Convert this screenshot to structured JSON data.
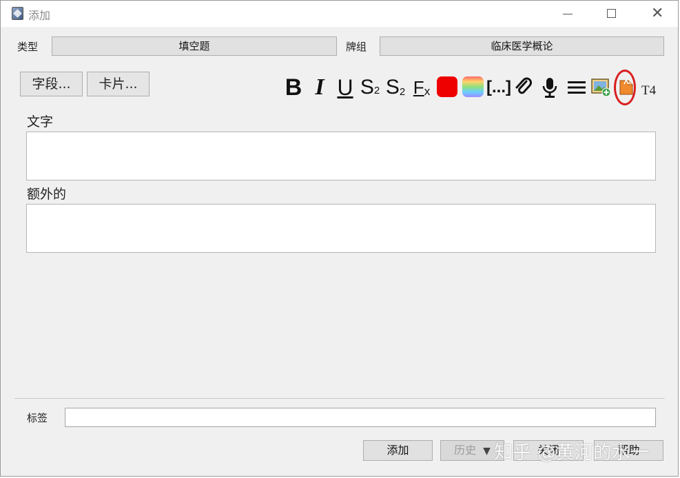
{
  "window": {
    "title": "添加"
  },
  "top": {
    "type_label": "类型",
    "type_value": "填空题",
    "deck_label": "牌组",
    "deck_value": "临床医学概论"
  },
  "buttons": {
    "fields": "字段...",
    "cards": "卡片..."
  },
  "toolbar": {
    "bold": "B",
    "italic": "I",
    "underline": "U",
    "superscript": "S",
    "superscript_mark": "2",
    "subscript": "S",
    "subscript_mark": "2",
    "clear_format": "F",
    "clear_format_mark": "x",
    "text_color": "#ef0000",
    "cloze": "[...]",
    "attach_icon": "paperclip-icon",
    "record_icon": "microphone-icon",
    "more_icon": "menu-icon",
    "image_icon": "image-occlusion-icon",
    "highlighted_icon": "import-icon",
    "t4": "T4",
    "highlight_color": "#d81e1e"
  },
  "fields": [
    {
      "label": "文字",
      "value": ""
    },
    {
      "label": "额外的",
      "value": ""
    }
  ],
  "tags": {
    "label": "标签",
    "value": ""
  },
  "actions": {
    "add": "添加",
    "history": "历史",
    "history_arrow": "▼",
    "close": "关闭",
    "help": "帮助"
  },
  "watermark": "知乎 @黄河的水一"
}
